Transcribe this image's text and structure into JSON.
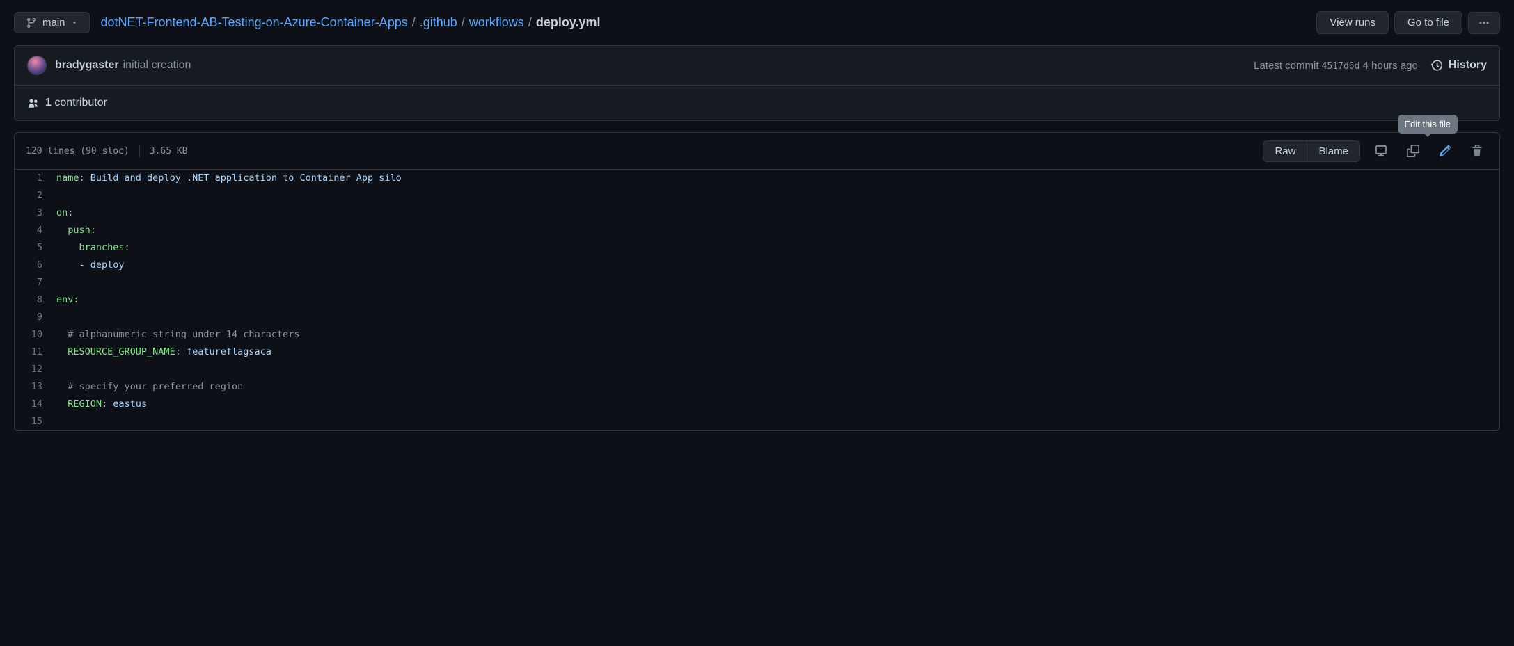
{
  "branch": {
    "name": "main"
  },
  "breadcrumb": {
    "repo": "dotNET-Frontend-AB-Testing-on-Azure-Container-Apps",
    "path1": ".github",
    "path2": "workflows",
    "current": "deploy.yml"
  },
  "actions": {
    "view_runs": "View runs",
    "go_to_file": "Go to file"
  },
  "commit": {
    "author": "bradygaster",
    "message": "initial creation",
    "latest_commit_label": "Latest commit",
    "hash": "4517d6d",
    "time": "4 hours ago",
    "history_label": "History"
  },
  "contributors": {
    "count": "1",
    "label": "contributor"
  },
  "file_info": {
    "lines": "120 lines (90 sloc)",
    "size": "3.65 KB"
  },
  "file_actions": {
    "raw": "Raw",
    "blame": "Blame",
    "edit_tooltip": "Edit this file"
  },
  "code": {
    "lines": [
      {
        "n": 1,
        "segments": [
          {
            "t": "name",
            "c": "pl-key"
          },
          {
            "t": ": ",
            "c": ""
          },
          {
            "t": "Build and deploy .NET application to Container App silo",
            "c": "pl-str"
          }
        ]
      },
      {
        "n": 2,
        "segments": []
      },
      {
        "n": 3,
        "segments": [
          {
            "t": "on",
            "c": "pl-key"
          },
          {
            "t": ":",
            "c": ""
          }
        ]
      },
      {
        "n": 4,
        "segments": [
          {
            "t": "  ",
            "c": ""
          },
          {
            "t": "push",
            "c": "pl-key"
          },
          {
            "t": ":",
            "c": ""
          }
        ]
      },
      {
        "n": 5,
        "segments": [
          {
            "t": "    ",
            "c": ""
          },
          {
            "t": "branches",
            "c": "pl-key"
          },
          {
            "t": ":",
            "c": ""
          }
        ]
      },
      {
        "n": 6,
        "segments": [
          {
            "t": "    - ",
            "c": ""
          },
          {
            "t": "deploy",
            "c": "pl-str"
          }
        ]
      },
      {
        "n": 7,
        "segments": []
      },
      {
        "n": 8,
        "segments": [
          {
            "t": "env",
            "c": "pl-key"
          },
          {
            "t": ":",
            "c": ""
          }
        ]
      },
      {
        "n": 9,
        "segments": []
      },
      {
        "n": 10,
        "segments": [
          {
            "t": "  ",
            "c": ""
          },
          {
            "t": "# alphanumeric string under 14 characters",
            "c": "pl-cmt"
          }
        ]
      },
      {
        "n": 11,
        "segments": [
          {
            "t": "  ",
            "c": ""
          },
          {
            "t": "RESOURCE_GROUP_NAME",
            "c": "pl-ent"
          },
          {
            "t": ": ",
            "c": ""
          },
          {
            "t": "featureflagsaca",
            "c": "pl-str"
          }
        ]
      },
      {
        "n": 12,
        "segments": []
      },
      {
        "n": 13,
        "segments": [
          {
            "t": "  ",
            "c": ""
          },
          {
            "t": "# specify your preferred region",
            "c": "pl-cmt"
          }
        ]
      },
      {
        "n": 14,
        "segments": [
          {
            "t": "  ",
            "c": ""
          },
          {
            "t": "REGION",
            "c": "pl-ent"
          },
          {
            "t": ": ",
            "c": ""
          },
          {
            "t": "eastus",
            "c": "pl-str"
          }
        ]
      },
      {
        "n": 15,
        "segments": []
      }
    ]
  }
}
